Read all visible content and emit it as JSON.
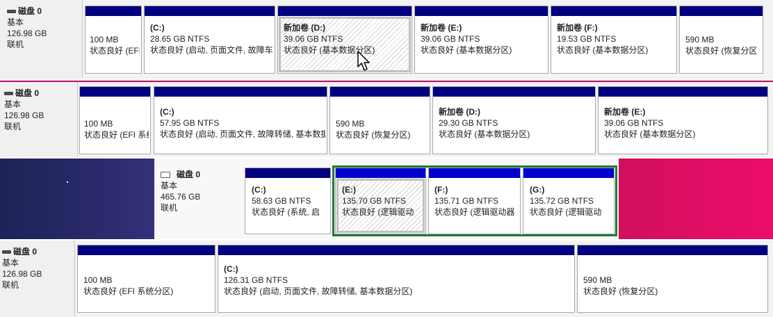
{
  "colors": {
    "bar": "#000080",
    "bar_light": "#0000cc",
    "selection_green": "#1f7a35",
    "wallpaper_pink": "#ec0c6c",
    "wallpaper_navy": "#1c2356"
  },
  "rows": [
    {
      "disk": {
        "name": "磁盘 0",
        "type": "基本",
        "size": "126.98 GB",
        "status": "联机",
        "icon": "disk-icon"
      },
      "partitions": [
        {
          "name": "",
          "size": "100 MB",
          "status": "状态良好 (EFI"
        },
        {
          "name": "(C:)",
          "size": "28.65 GB NTFS",
          "status": "状态良好 (启动, 页面文件, 故障车"
        },
        {
          "name": "新加卷 (D:)",
          "size": "39.06 GB NTFS",
          "status": "状态良好 (基本数据分区)"
        },
        {
          "name": "新加卷 (E:)",
          "size": "39.06 GB NTFS",
          "status": "状态良好 (基本数据分区)"
        },
        {
          "name": "新加卷 (F:)",
          "size": "19.53 GB NTFS",
          "status": "状态良好 (基本数据分区)"
        },
        {
          "name": "",
          "size": "590 MB",
          "status": "状态良好 (恢复分区"
        }
      ]
    },
    {
      "disk": {
        "name": "磁盘 0",
        "type": "基本",
        "size": "126.98 GB",
        "status": "联机",
        "icon": "disk-icon"
      },
      "partitions": [
        {
          "name": "",
          "size": "100 MB",
          "status": "状态良好 (EFI 系统"
        },
        {
          "name": "(C:)",
          "size": "57.95 GB NTFS",
          "status": "状态良好 (启动, 页面文件, 故障转储, 基本数据"
        },
        {
          "name": "",
          "size": "590 MB",
          "status": "状态良好 (恢复分区)"
        },
        {
          "name": "新加卷 (D:)",
          "size": "29.30 GB NTFS",
          "status": "状态良好 (基本数据分区)"
        },
        {
          "name": "新加卷 (E:)",
          "size": "39.06 GB NTFS",
          "status": "状态良好 (基本数据分区)"
        }
      ]
    },
    {
      "disk": {
        "name": "磁盘 0",
        "type": "基本",
        "size": "465.76 GB",
        "status": "联机",
        "icon": "disk-icon"
      },
      "partitions": [
        {
          "name": "(C:)",
          "size": "58.63 GB NTFS",
          "status": "状态良好 (系统, 启"
        },
        {
          "name": "(E:)",
          "size": "135.70 GB NTFS",
          "status": "状态良好 (逻辑驱动"
        },
        {
          "name": "(F:)",
          "size": "135.71 GB NTFS",
          "status": "状态良好 (逻辑驱动器"
        },
        {
          "name": "(G:)",
          "size": "135.72 GB NTFS",
          "status": "状态良好 (逻辑驱动"
        }
      ]
    },
    {
      "disk": {
        "name": "磁盘 0",
        "type": "基本",
        "size": "126.98 GB",
        "status": "联机",
        "icon": "disk-icon"
      },
      "partitions": [
        {
          "name": "",
          "size": "100 MB",
          "status": "状态良好 (EFI 系统分区)"
        },
        {
          "name": "(C:)",
          "size": "126.31 GB NTFS",
          "status": "状态良好 (启动, 页面文件, 故障转储, 基本数据分区)"
        },
        {
          "name": "",
          "size": "590 MB",
          "status": "状态良好 (恢复分区)"
        }
      ]
    }
  ]
}
